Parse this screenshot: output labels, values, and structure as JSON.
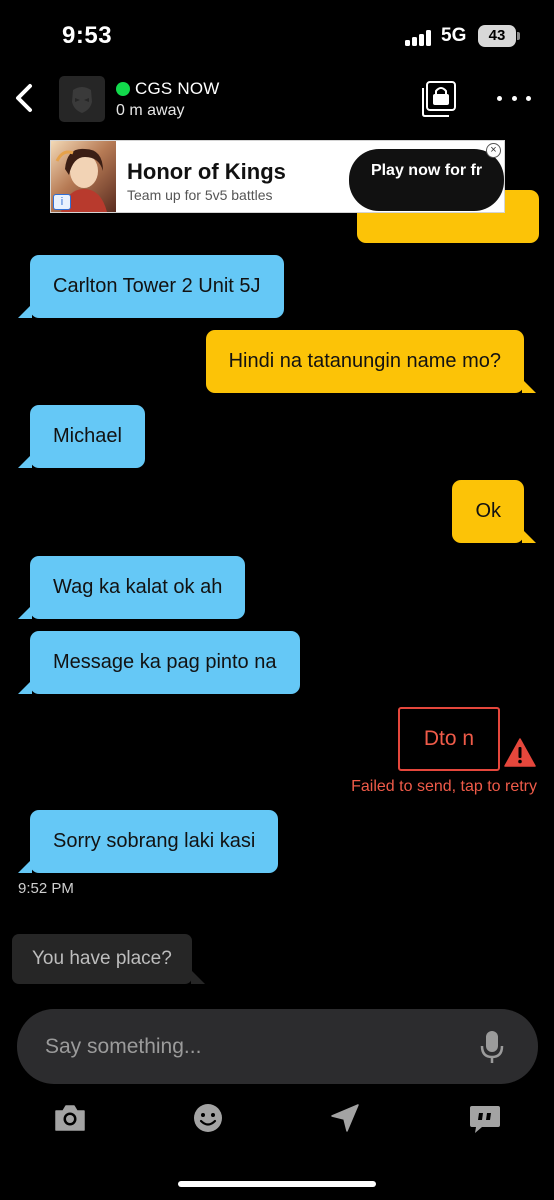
{
  "status_bar": {
    "time": "9:53",
    "network": "5G",
    "battery": "43"
  },
  "header": {
    "contact_name": "CGS NOW",
    "distance": "0 m away",
    "online_color": "#12d94c",
    "icons": [
      "back-chevron-icon",
      "album-lock-icon",
      "more-dots-icon"
    ]
  },
  "ad": {
    "title": "Honor of Kings",
    "subtitle": "Team up for 5v5 battles",
    "cta": "Play now for fr",
    "close": "×",
    "info": "i"
  },
  "messages": [
    {
      "from": "them",
      "text": "Carlton Tower 2 Unit 5J"
    },
    {
      "from": "me",
      "text": "Hindi na tatanungin name mo?"
    },
    {
      "from": "them",
      "text": "Michael"
    },
    {
      "from": "me",
      "text": "Ok"
    },
    {
      "from": "them",
      "text": "Wag ka kalat ok ah"
    },
    {
      "from": "them",
      "text": "Message ka pag pinto na"
    },
    {
      "from": "me",
      "text": "Dto n",
      "status": "failed"
    },
    {
      "from": "them",
      "text": "Sorry sobrang laki kasi"
    }
  ],
  "failed_note": "Failed to send, tap to retry",
  "timestamp": "9:52 PM",
  "suggestion": "You have place?",
  "composer": {
    "placeholder": "Say something..."
  },
  "toolbar": [
    "camera-icon",
    "emoji-icon",
    "location-icon",
    "saved-phrases-icon"
  ],
  "colors": {
    "incoming_bubble": "#65c8f6",
    "outgoing_bubble": "#fcc307",
    "error": "#ef5b49",
    "background": "#000000"
  }
}
